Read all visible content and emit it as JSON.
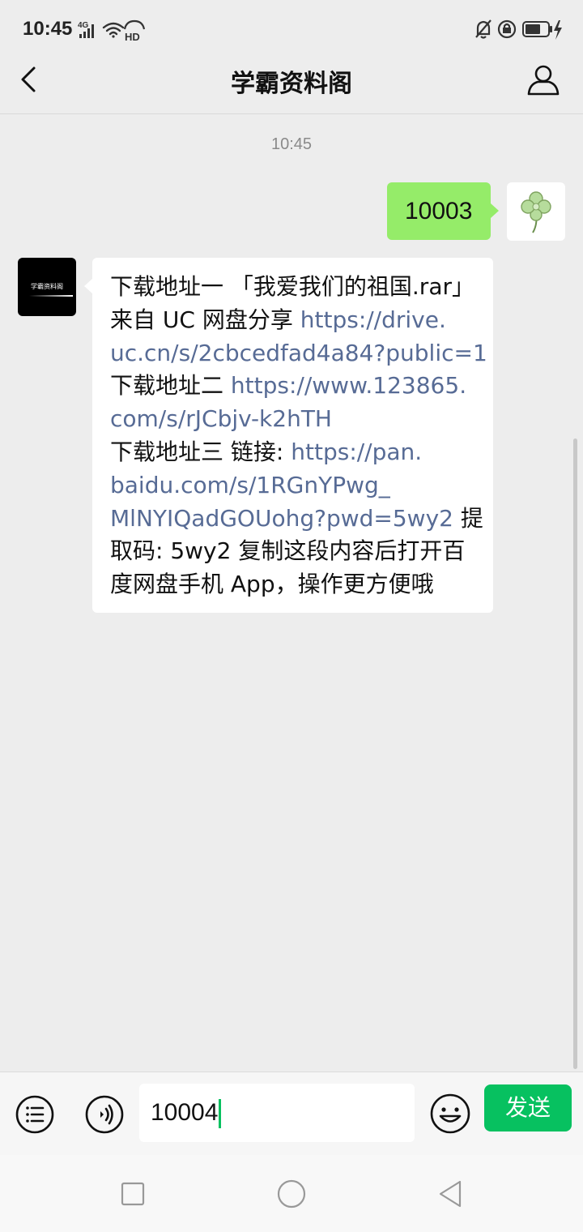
{
  "status_bar": {
    "time": "10:45",
    "network": "4G",
    "hd": "HD",
    "icons": [
      "signal-icon",
      "wifi-icon",
      "hd-call-icon",
      "mute-bell-icon",
      "lock-rotation-icon",
      "battery-icon",
      "charging-icon"
    ]
  },
  "nav": {
    "title": "学霸资料阁",
    "back_icon": "back-chevron-icon",
    "profile_icon": "person-icon"
  },
  "chat": {
    "timestamp": "10:45",
    "self_message": "10003",
    "bot_avatar_text": "学霸资料阁",
    "bot_message": {
      "lines": [
        [
          {
            "text": "下载地址一 「我爱我们的祖国.rar」",
            "link": false
          }
        ],
        [
          {
            "text": "来自 UC 网盘分享 ",
            "link": false
          },
          {
            "text": "https://drive.",
            "link": true
          }
        ],
        [
          {
            "text": "uc.cn/s/2cbcedfad4a84?public=1",
            "link": true
          }
        ],
        [
          {
            "text": "下载地址二 ",
            "link": false
          },
          {
            "text": "https://www.123865.",
            "link": true
          }
        ],
        [
          {
            "text": "com/s/rJCbjv-k2hTH",
            "link": true
          }
        ],
        [
          {
            "text": "下载地址三 链接: ",
            "link": false
          },
          {
            "text": "https://pan.",
            "link": true
          }
        ],
        [
          {
            "text": "baidu.com/s/1RGnYPwg_",
            "link": true
          }
        ],
        [
          {
            "text": "MlNYIQadGOUohg?pwd=5wy2",
            "link": true
          },
          {
            "text": " 提",
            "link": false
          }
        ],
        [
          {
            "text": "取码: 5wy2 复制这段内容后打开百",
            "link": false
          }
        ],
        [
          {
            "text": "度网盘手机 App，操作更方便哦",
            "link": false
          }
        ]
      ]
    },
    "colors": {
      "self_bubble": "#95ec69",
      "link": "#576b95",
      "background": "#ededed"
    }
  },
  "input_bar": {
    "input_value": "10004",
    "send_label": "发送",
    "send_color": "#07c160"
  },
  "system_nav": {
    "icons": [
      "recent-apps-icon",
      "home-icon",
      "back-triangle-icon"
    ]
  }
}
